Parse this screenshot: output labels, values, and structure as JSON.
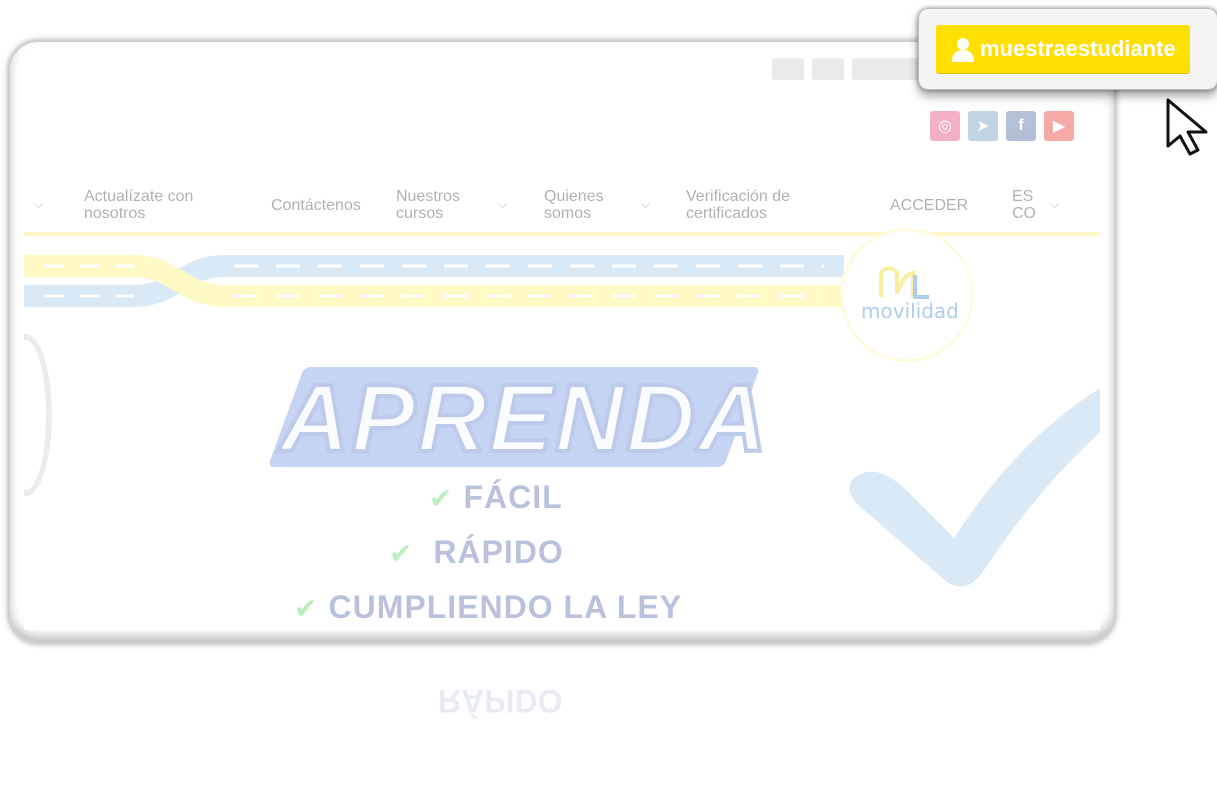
{
  "user": {
    "name": "muestraestudiante"
  },
  "nav": {
    "items": [
      {
        "label": "Actualízate con nosotros",
        "line1": "Actualízate con",
        "line2": "nosotros"
      },
      {
        "label": "Contáctenos"
      },
      {
        "label": "Nuestros cursos",
        "line1": "Nuestros",
        "line2": "cursos"
      },
      {
        "label": "Quienes somos",
        "line1": "Quienes",
        "line2": "somos"
      },
      {
        "label": "Verificación de certificados",
        "line1": "Verificación de",
        "line2": "certificados"
      },
      {
        "label": "ACCEDER"
      },
      {
        "label": "ES CO",
        "line1": "ES",
        "line2": "CO"
      }
    ]
  },
  "logo": {
    "text": "movilidad"
  },
  "hero": {
    "title": "APRENDA",
    "bullets": [
      "FÁCIL",
      "RÁPIDO",
      "CUMPLIENDO LA LEY"
    ]
  },
  "social": [
    {
      "name": "instagram-icon",
      "color": "#e1306c",
      "glyph": "◎"
    },
    {
      "name": "telegram-icon",
      "color": "#5b8fb9",
      "glyph": "➤"
    },
    {
      "name": "facebook-icon",
      "color": "#3b5998",
      "glyph": "f"
    },
    {
      "name": "youtube-icon",
      "color": "#e62117",
      "glyph": "▶"
    }
  ],
  "colors": {
    "accent": "#ffe000",
    "road_yellow": "#fff06a",
    "road_blue": "#9ec6ea"
  }
}
